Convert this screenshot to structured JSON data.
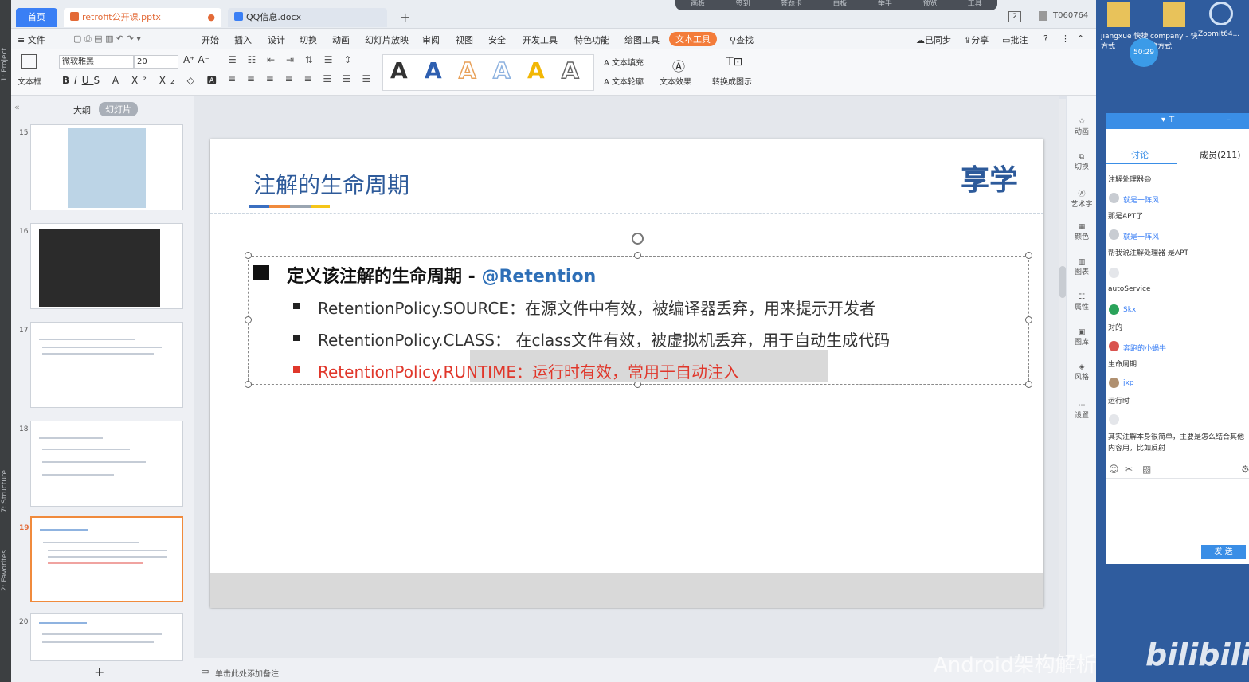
{
  "ide": {
    "project_label": "1: Project",
    "structure_label": "7: Structure",
    "favorites_label": "2: Favorites"
  },
  "tabs": {
    "home": "首页",
    "ppt": "retrofit公开课.pptx",
    "doc": "QQ信息.docx",
    "add": "+"
  },
  "overlay_bar": [
    "画板",
    "签到",
    "答题卡",
    "白板",
    "举手",
    "预览",
    "工具"
  ],
  "window": {
    "code": "T060764",
    "badge": "2"
  },
  "menu": {
    "file": "≡ 文件",
    "items": [
      "开始",
      "插入",
      "设计",
      "切换",
      "动画",
      "幻灯片放映",
      "审阅",
      "视图",
      "安全",
      "开发工具",
      "特色功能",
      "绘图工具",
      "文本工具"
    ],
    "search": "查找",
    "sync": "已同步",
    "share": "分享",
    "comment": "批注"
  },
  "ribbon": {
    "textbox_label": "文本框",
    "font_name": "微软雅黑",
    "font_size": "20",
    "art_letters": [
      "A",
      "A",
      "A",
      "A",
      "A",
      "A"
    ],
    "art_colors": [
      "#111111",
      "#2e5fb0",
      "#e8a15a",
      "#8fb3e0",
      "#f2b705",
      "#666666"
    ],
    "text_fill": "文本填充",
    "text_outline": "文本轮廓",
    "text_effect": "文本效果",
    "art_char": "艺术字",
    "convert_shape": "转换成图示"
  },
  "panel": {
    "outline_tab": "大纲",
    "slides_tab": "幻灯片"
  },
  "thumbnails": [
    {
      "num": "15"
    },
    {
      "num": "16"
    },
    {
      "num": "17"
    },
    {
      "num": "18"
    },
    {
      "num": "19"
    },
    {
      "num": "20"
    }
  ],
  "slide": {
    "title": "注解的生命周期",
    "logo_text": "享学",
    "heading_prefix": "定义该注解的生命周期 - ",
    "heading_annotation": "@Retention",
    "bullets": [
      {
        "text": "RetentionPolicy.SOURCE：在源文件中有效，被编译器丢弃，用来提示开发者",
        "color": "#333333"
      },
      {
        "text": "RetentionPolicy.CLASS： 在class文件有效，被虚拟机丢弃，用于自动生成代码",
        "color": "#333333"
      },
      {
        "text": "RetentionPolicy.RUNTIME：运行时有效，常用于自动注入",
        "color": "#e0372b"
      }
    ],
    "title_bar_colors": [
      "#3b6fc0",
      "#f08a3c",
      "#9aa5b1",
      "#f5c518"
    ]
  },
  "tools": [
    "动画",
    "切换",
    "艺术字",
    "颜色",
    "图表",
    "属性",
    "图库",
    "风格",
    "设置"
  ],
  "status": {
    "notes_placeholder": "单击此处添加备注"
  },
  "desktop": {
    "icons": [
      "jiangxue 快捷方式",
      "company - 快捷方式",
      "ZoomIt64..."
    ],
    "timer": "50:29",
    "watermark": "Android架构解析",
    "bili": "bilibili"
  },
  "chat": {
    "tab_discuss": "讨论",
    "tab_members": "成员(211)",
    "messages": [
      {
        "type": "text",
        "text": "注解处理器😄"
      },
      {
        "type": "user",
        "text": "就是一阵风"
      },
      {
        "type": "text",
        "text": "那是APT了"
      },
      {
        "type": "user",
        "text": "就是一阵风"
      },
      {
        "type": "text",
        "text": "帮我说注解处理器 是APT"
      },
      {
        "type": "user",
        "text": ""
      },
      {
        "type": "text",
        "text": "autoService"
      },
      {
        "type": "user",
        "text": "Skx"
      },
      {
        "type": "text",
        "text": "对的"
      },
      {
        "type": "user",
        "text": "奔跑的小蜗牛"
      },
      {
        "type": "text",
        "text": "生命周期"
      },
      {
        "type": "user",
        "text": "jxp"
      },
      {
        "type": "text",
        "text": "运行时"
      },
      {
        "type": "user",
        "text": ""
      },
      {
        "type": "text",
        "text": "其实注解本身很简单，主要是怎么结合其他内容用，比如反射"
      }
    ],
    "send": "发 送"
  }
}
